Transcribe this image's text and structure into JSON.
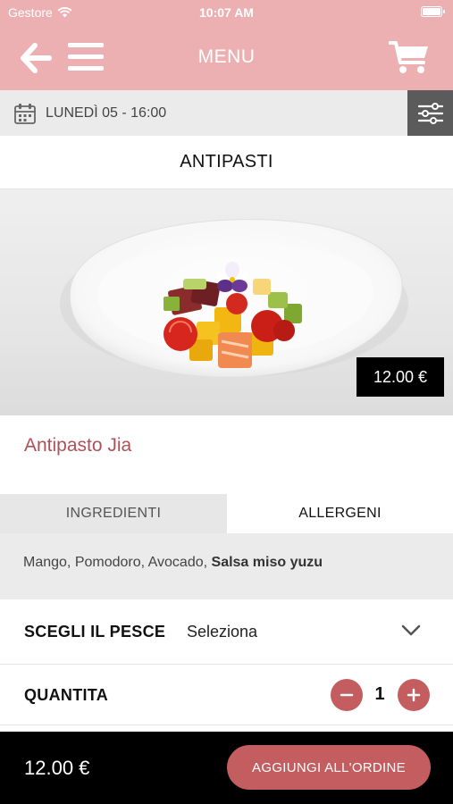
{
  "status_bar": {
    "carrier": "Gestore",
    "time": "10:07 AM"
  },
  "nav": {
    "title": "MENU"
  },
  "date_bar": {
    "date": "LUNEDÌ 05 - 16:00"
  },
  "section": {
    "title": "ANTIPASTI"
  },
  "product": {
    "price": "12.00 €",
    "name": "Antipasto Jia",
    "image_alt": "Antipasto Jia"
  },
  "tabs": {
    "ingredients": "INGREDIENTI",
    "allergens": "ALLERGENI"
  },
  "ingredients": {
    "regular": "Mango, Pomodoro, Avocado, ",
    "bold": "Salsa miso yuzu"
  },
  "fish": {
    "label": "SCEGLI IL PESCE",
    "value": "Seleziona"
  },
  "quantity": {
    "label": "QUANTITA",
    "value": "1"
  },
  "footer": {
    "total": "12.00 €",
    "add_button": "AGGIUNGI ALL'ORDINE"
  },
  "colors": {
    "header_pink": "#ecb0b2",
    "accent_red": "#c35d5f",
    "dish_name": "#b05058",
    "filter_bg": "#5b5b5b",
    "footer_bg": "#000000"
  },
  "icons": {
    "back": "arrow-left-icon",
    "menu": "hamburger-icon",
    "cart": "cart-icon",
    "calendar": "calendar-icon",
    "filter": "sliders-icon",
    "chevron": "chevron-down-icon",
    "wifi": "wifi-icon",
    "battery": "battery-icon"
  }
}
